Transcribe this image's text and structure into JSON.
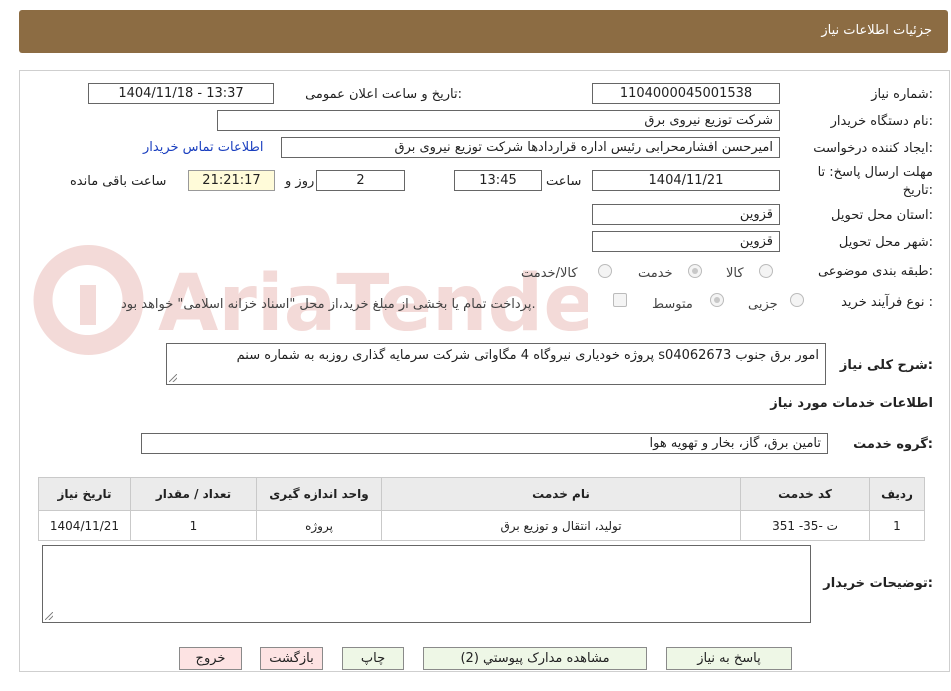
{
  "header": {
    "title": "جزئیات اطلاعات نیاز"
  },
  "fields": {
    "need_number_label": "شماره نیاز:",
    "need_number": "1104000045001538",
    "announce_label": "تاریخ و ساعت اعلان عمومی:",
    "announce_value": "1404/11/18 - 13:37",
    "buyer_org_label": "نام دستگاه خریدار:",
    "buyer_org": "شرکت توزیع نیروی برق",
    "creator_label": "ایجاد کننده درخواست:",
    "creator": "امیرحسن افشارمحرابی رئیس اداره قراردادها شرکت توزیع نیروی برق",
    "contact_link": "اطلاعات تماس خریدار",
    "deadline_label_1": "مهلت ارسال پاسخ: تا",
    "deadline_label_2": "تاریخ:",
    "deadline_date": "1404/11/21",
    "time_label": "ساعت",
    "deadline_time": "13:45",
    "days_value": "2",
    "days_label": "روز و",
    "remaining_time": "21:21:17",
    "remaining_label": "ساعت باقی مانده",
    "province_label": "استان محل تحویل:",
    "province": "قزوین",
    "city_label": "شهر محل تحویل:",
    "city": "قزوین",
    "category_label": "طبقه بندی موضوعی:",
    "category_options": [
      "کالا",
      "خدمت",
      "کالا/خدمت"
    ],
    "category_selected": "خدمت",
    "process_label": "نوع فرآیند خرید :",
    "process_options": [
      "جزیی",
      "متوسط"
    ],
    "process_selected": "متوسط",
    "payment_note": "پرداخت تمام یا بخشی از مبلغ خرید،از محل \"اسناد خزانه اسلامی\" خواهد بود.",
    "summary_label": "شرح کلی نیاز:",
    "summary": "پروژه خودیاری نیروگاه 4 مگاواتی شرکت سرمایه گذاری روزبه به شماره سنم s04062673 امور برق جنوب"
  },
  "services": {
    "section_title": "اطلاعات خدمات مورد نیاز",
    "group_label": "گروه خدمت:",
    "group_value": "تامین برق، گاز، بخار و تهویه هوا",
    "columns": [
      "ردیف",
      "کد خدمت",
      "نام خدمت",
      "واحد اندازه گیری",
      "تعداد / مقدار",
      "تاریخ نیاز"
    ],
    "rows": [
      [
        "1",
        "ت -35- 351",
        "تولید، انتقال و توزیع برق",
        "پروژه",
        "1",
        "1404/11/21"
      ]
    ]
  },
  "buyer_notes": {
    "label": "توضیحات خریدار:",
    "value": ""
  },
  "buttons": {
    "reply": "پاسخ به نیاز",
    "attachments": "مشاهده مدارک پیوستي (2)",
    "print": "چاپ",
    "back": "بازگشت",
    "exit": "خروج"
  },
  "watermark": {
    "text": "AriaTender.neT"
  }
}
